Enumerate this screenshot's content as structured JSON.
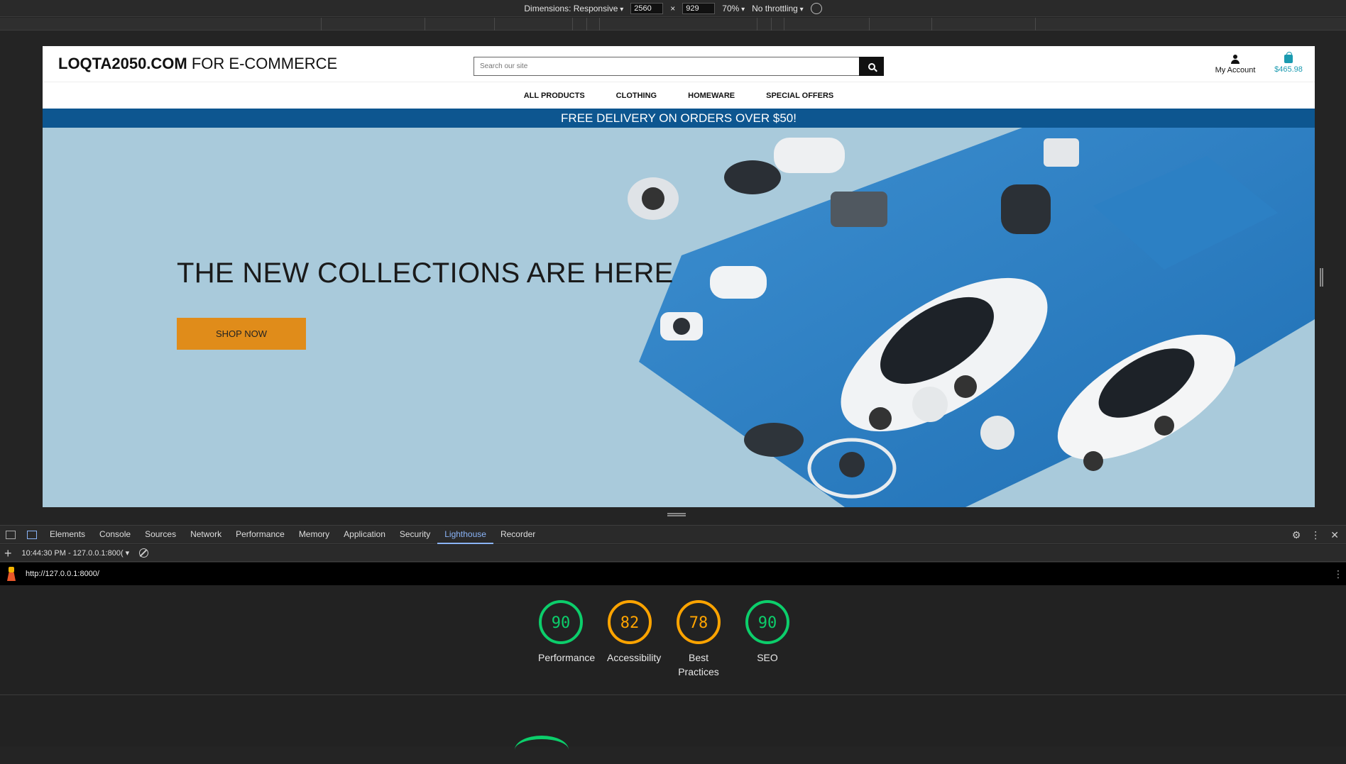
{
  "device_toolbar": {
    "dimensions": "Dimensions: Responsive",
    "width": "2560",
    "times": "×",
    "height": "929",
    "zoom": "70%",
    "throttling": "No throttling"
  },
  "site": {
    "logo_bold": "LOQTA2050.COM",
    "logo_rest": " FOR E-COMMERCE",
    "search_placeholder": "Search our site",
    "account_label": "My Account",
    "cart_total": "$465.98",
    "nav": [
      "ALL PRODUCTS",
      "CLOTHING",
      "HOMEWARE",
      "SPECIAL OFFERS"
    ],
    "promo": "FREE DELIVERY ON ORDERS OVER $50!",
    "hero_title": "THE NEW COLLECTIONS ARE HERE",
    "hero_button": "SHOP NOW"
  },
  "devtools": {
    "tabs": [
      "Elements",
      "Console",
      "Sources",
      "Network",
      "Performance",
      "Memory",
      "Application",
      "Security",
      "Lighthouse",
      "Recorder"
    ],
    "active_tab": "Lighthouse",
    "report_select": "10:44:30 PM - 127.0.0.1:800(",
    "url": "http://127.0.0.1:8000/"
  },
  "lighthouse": {
    "scores": [
      {
        "label": "Performance",
        "value": 90,
        "color": "#0cce6b"
      },
      {
        "label": "Accessibility",
        "value": 82,
        "color": "#ffa400"
      },
      {
        "label": "Best Practices",
        "value": 78,
        "color": "#ffa400"
      },
      {
        "label": "SEO",
        "value": 90,
        "color": "#0cce6b"
      }
    ]
  },
  "colors": {
    "brand_blue": "#0d5690",
    "cta_orange": "#e08c1a",
    "cart_teal": "#1a9ab0",
    "pass_green": "#0cce6b",
    "average_orange": "#ffa400"
  }
}
